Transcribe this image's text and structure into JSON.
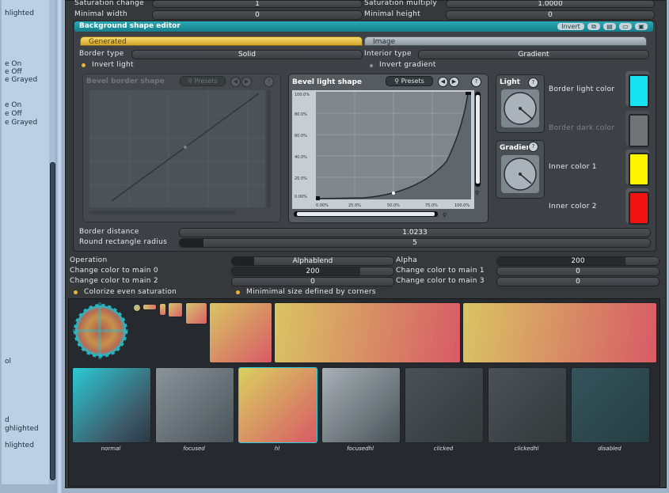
{
  "left_panel": {
    "items": [
      "hlighted",
      "e On",
      "e Off",
      "e Grayed",
      "e On",
      "e Off",
      "e Grayed",
      "ol",
      "d",
      "ghlighted",
      "hlighted"
    ]
  },
  "top_rows": {
    "saturation_change_label": "Saturation change",
    "saturation_change_value": "1",
    "saturation_multiply_label": "Saturation multiply",
    "saturation_multiply_value": "1.0000",
    "minimal_width_label": "Minimal width",
    "minimal_width_value": "0",
    "minimal_height_label": "Minimal height",
    "minimal_height_value": "0"
  },
  "editor": {
    "title": "Background shape editor",
    "header_buttons": [
      "Invert"
    ],
    "tabs": [
      "Generated",
      "Image"
    ],
    "border_type_label": "Border type",
    "border_type_value": "Solid",
    "interior_type_label": "Interior type",
    "interior_type_value": "Gradient",
    "invert_light_label": "Invert light",
    "invert_gradient_label": "Invert gradient",
    "bevel_border": {
      "title": "Bevel border shape",
      "presets_label": "Presets",
      "help": "?"
    },
    "bevel_light": {
      "title": "Bevel light shape",
      "presets_label": "Presets",
      "help": "?",
      "y_ticks": [
        "100.0%",
        "80.0%",
        "60.0%",
        "40.0%",
        "20.0%",
        "0.00%"
      ],
      "x_ticks": [
        "0.00%",
        "25.0%",
        "50.0%",
        "75.0%",
        "100.0%"
      ]
    },
    "light_title": "Light",
    "gradient_title": "Gradient",
    "colors": {
      "border_light_label": "Border light color",
      "border_light_hex": "#16e2f2",
      "border_dark_label": "Border dark color",
      "border_dark_hex": "#707476",
      "inner1_label": "Inner color 1",
      "inner1_hex": "#fff400",
      "inner2_label": "Inner color 2",
      "inner2_hex": "#f21212"
    },
    "border_distance_label": "Border distance",
    "border_distance_value": "1.0233",
    "round_radius_label": "Round rectangle radius",
    "round_radius_value": "5"
  },
  "ops": {
    "operation_label": "Operation",
    "operation_value": "Alphablend",
    "alpha_label": "Alpha",
    "alpha_value": "200",
    "ccm0_label": "Change color to main 0",
    "ccm0_value": "200",
    "ccm1_label": "Change color to main 1",
    "ccm1_value": "0",
    "ccm2_label": "Change color to main 2",
    "ccm2_value": "0",
    "ccm3_label": "Change color to main 3",
    "ccm3_value": "0",
    "colorize_label": "Colorize even saturation",
    "minsize_label": "Minimimal size defined by corners"
  },
  "states": [
    "normal",
    "focused",
    "hl",
    "focusedhl",
    "clicked",
    "clickedhl",
    "disabled"
  ]
}
